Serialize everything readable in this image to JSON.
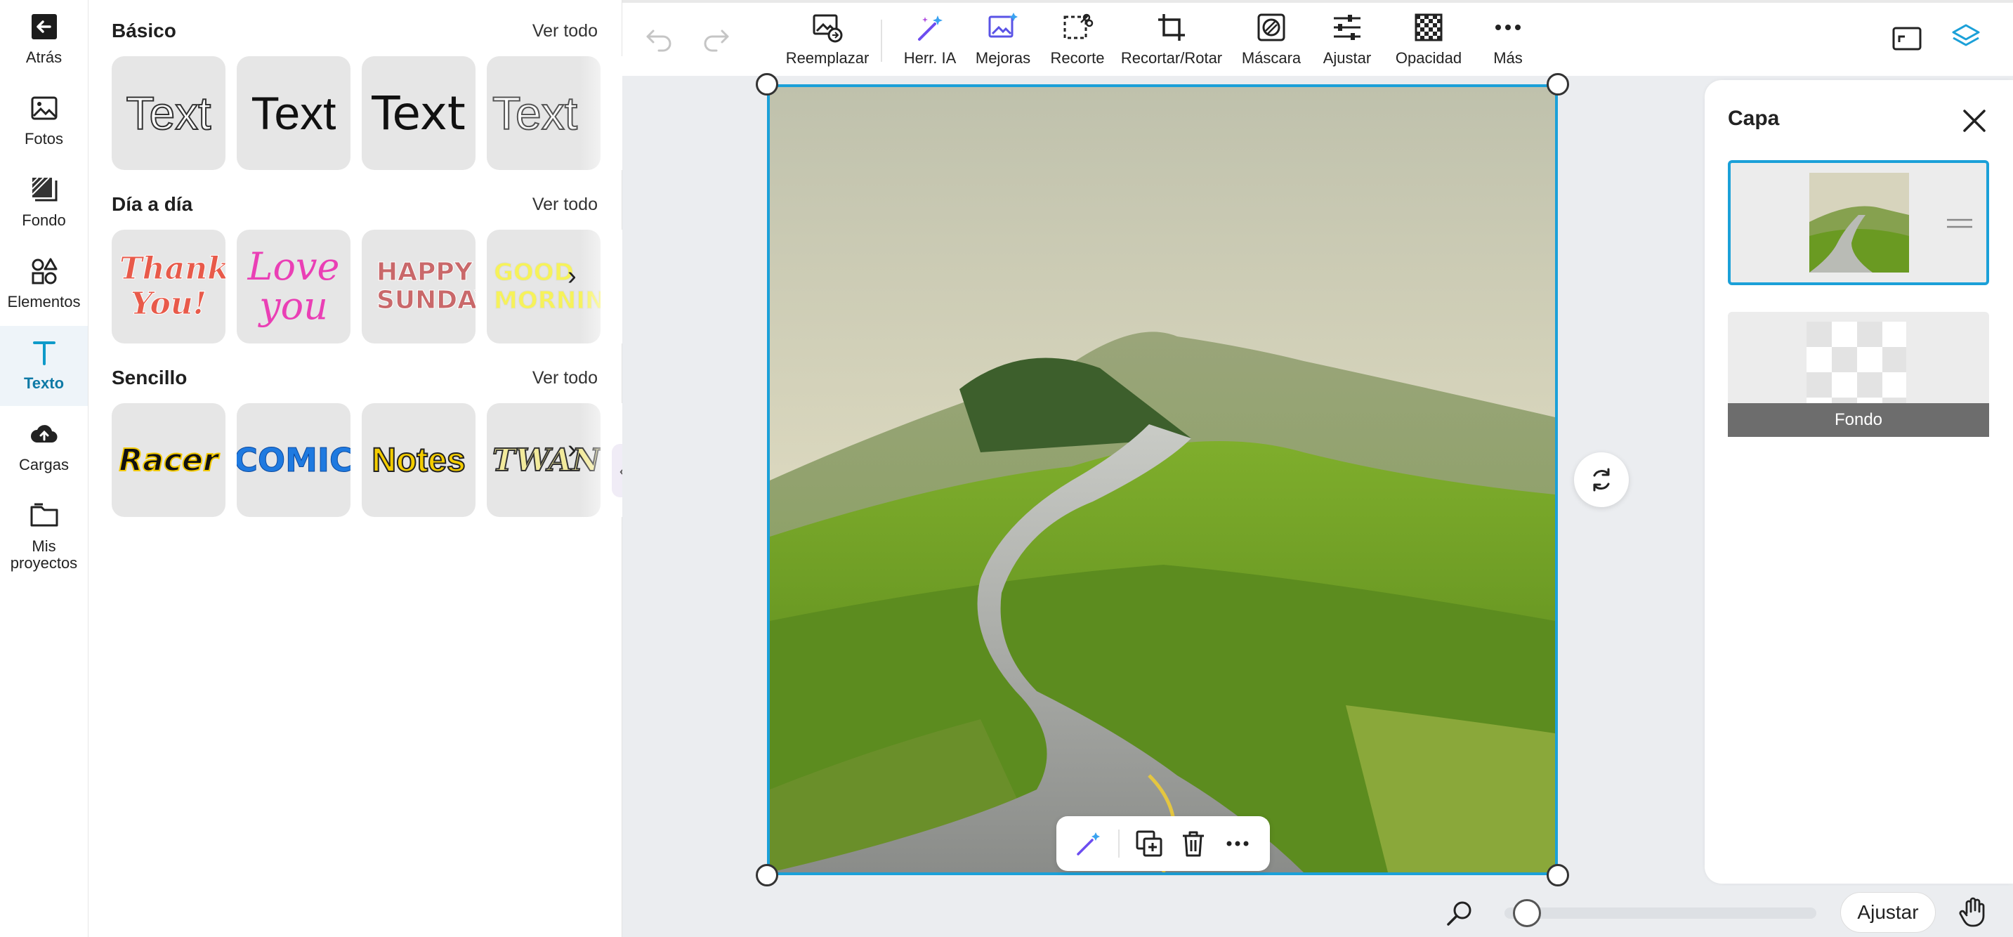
{
  "rail": {
    "items": [
      {
        "label": "Atrás",
        "icon": "arrow-left-icon"
      },
      {
        "label": "Fotos",
        "icon": "image-icon"
      },
      {
        "label": "Fondo",
        "icon": "background-icon"
      },
      {
        "label": "Elementos",
        "icon": "shapes-icon"
      },
      {
        "label": "Texto",
        "icon": "text-icon"
      },
      {
        "label": "Cargas",
        "icon": "cloud-upload-icon"
      },
      {
        "label": "Mis proyectos",
        "icon": "folder-icon"
      }
    ],
    "active_index": 4
  },
  "panel": {
    "sections": [
      {
        "title": "Básico",
        "link": "Ver todo",
        "tiles": [
          "Text",
          "Text",
          "Text",
          "Text"
        ]
      },
      {
        "title": "Día a día",
        "link": "Ver todo",
        "tiles": [
          "Thank You!",
          "Love you",
          "HAPPY SUNDAY",
          "GOOD MORNING"
        ]
      },
      {
        "title": "Sencillo",
        "link": "Ver todo",
        "tiles": [
          "Racer",
          "COMIC",
          "Notes",
          "TWANG"
        ]
      }
    ]
  },
  "toolbar": {
    "tools": [
      {
        "label": "Reemplazar",
        "icon": "replace-image-icon"
      },
      {
        "label": "Herr. IA",
        "icon": "magic-wand-icon"
      },
      {
        "label": "Mejoras",
        "icon": "enhance-image-icon"
      },
      {
        "label": "Recorte",
        "icon": "cutout-icon"
      },
      {
        "label": "Recortar/Rotar",
        "icon": "crop-icon"
      },
      {
        "label": "Máscara",
        "icon": "mask-icon"
      },
      {
        "label": "Ajustar",
        "icon": "sliders-icon"
      },
      {
        "label": "Opacidad",
        "icon": "checkerboard-icon"
      },
      {
        "label": "Más",
        "icon": "more-icon"
      }
    ]
  },
  "layer_panel": {
    "title": "Capa",
    "layers": [
      {
        "label": "",
        "selected": true
      },
      {
        "label": "Fondo",
        "selected": false
      }
    ]
  },
  "zoom": {
    "fit_label": "Ajustar",
    "level": 0.03
  },
  "colors": {
    "accent": "#1ba0d8",
    "active_rail": "#0f7aa6"
  }
}
